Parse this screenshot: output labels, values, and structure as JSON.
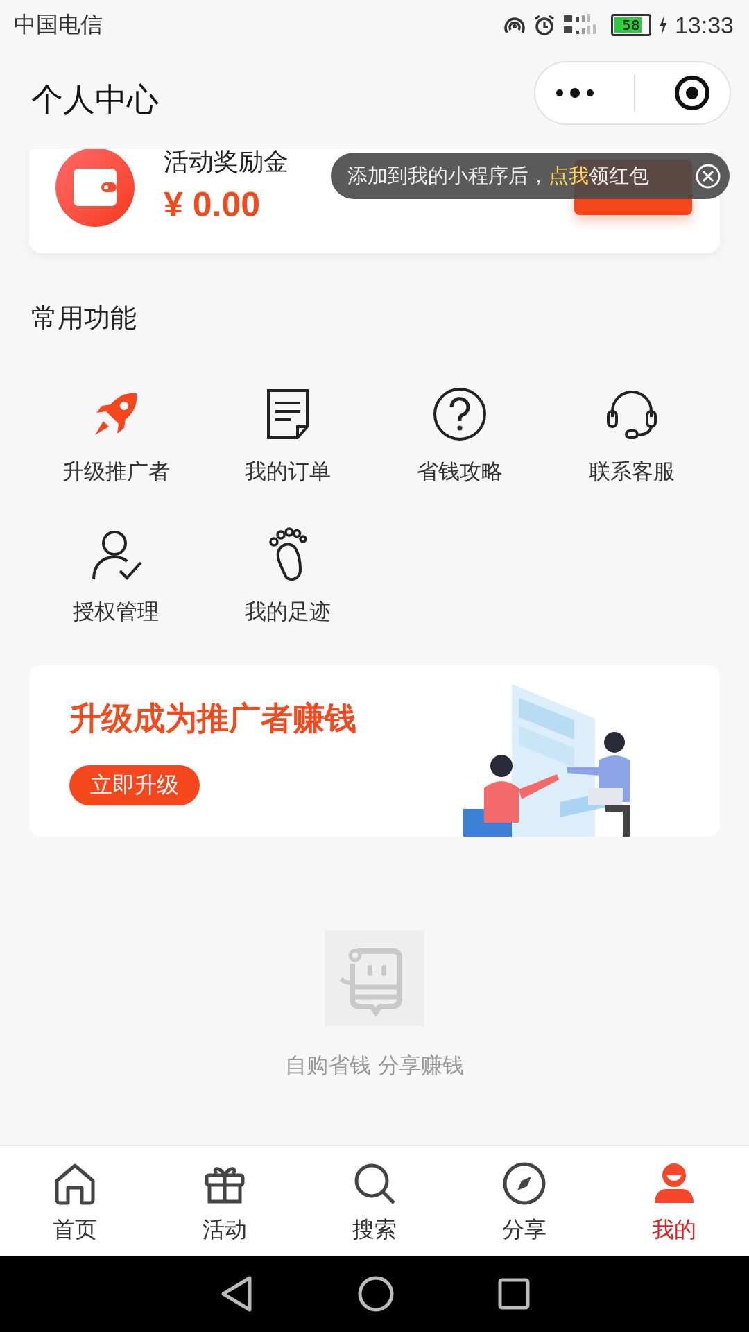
{
  "status_bar": {
    "carrier": "中国电信",
    "battery": "58",
    "time": "13:33"
  },
  "header": {
    "title": "个人中心"
  },
  "reward_card": {
    "label": "活动奖励金",
    "amount": "¥ 0.00"
  },
  "tooltip": {
    "parts": [
      {
        "text": "添加到我的小程序后，",
        "highlight": false
      },
      {
        "text": "点我",
        "highlight": true
      },
      {
        "text": "领红包",
        "highlight": false
      }
    ]
  },
  "section": {
    "title": "常用功能"
  },
  "functions": [
    {
      "label": "升级推广者"
    },
    {
      "label": "我的订单"
    },
    {
      "label": "省钱攻略"
    },
    {
      "label": "联系客服"
    },
    {
      "label": "授权管理"
    },
    {
      "label": "我的足迹"
    }
  ],
  "banner": {
    "title": "升级成为推广者赚钱",
    "button": "立即升级"
  },
  "footer": {
    "slogan": "自购省钱 分享赚钱"
  },
  "tabs": [
    {
      "label": "首页",
      "selected": false
    },
    {
      "label": "活动",
      "selected": false
    },
    {
      "label": "搜索",
      "selected": false
    },
    {
      "label": "分享",
      "selected": false
    },
    {
      "label": "我的",
      "selected": true
    }
  ]
}
